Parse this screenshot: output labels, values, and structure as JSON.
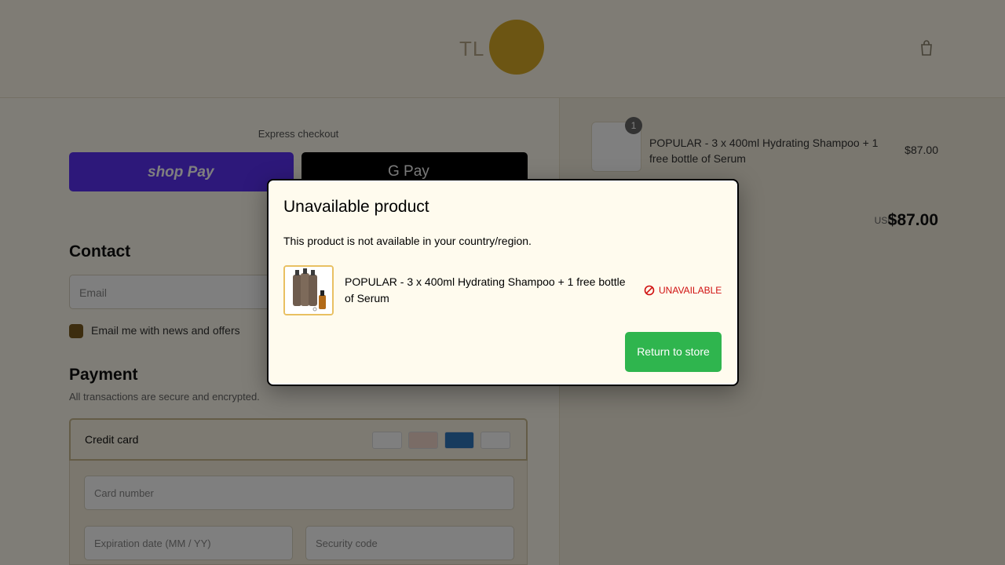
{
  "header": {
    "logo_text": "TL",
    "cart_icon": "cart-icon"
  },
  "checkout": {
    "express_label": "Express checkout",
    "shoppay_label": "shop Pay",
    "gpay_label": "G Pay",
    "contact_heading": "Contact",
    "email_placeholder": "Email",
    "newsletter_label": "Email me with news and offers",
    "payment_heading": "Payment",
    "payment_subtitle": "All transactions are secure and encrypted.",
    "credit_card_label": "Credit card",
    "card_number_placeholder": "Card number",
    "expiration_placeholder": "Expiration date (MM / YY)",
    "security_placeholder": "Security code"
  },
  "summary": {
    "product_qty": "1",
    "product_name": "POPULAR - 3 x 400ml Hydrating Shampoo + 1 free bottle of Serum",
    "product_price": "$87.00",
    "total_label": "USD",
    "total_value": "$87.00"
  },
  "modal": {
    "title": "Unavailable product",
    "message": "This product is not available in your country/region.",
    "product_name": "POPULAR - 3 x 400ml Hydrating Shampoo + 1 free bottle of Serum",
    "status": "UNAVAILABLE",
    "status_color": "#d01010",
    "return_button": "Return to store",
    "return_button_color": "#2fb54e"
  }
}
